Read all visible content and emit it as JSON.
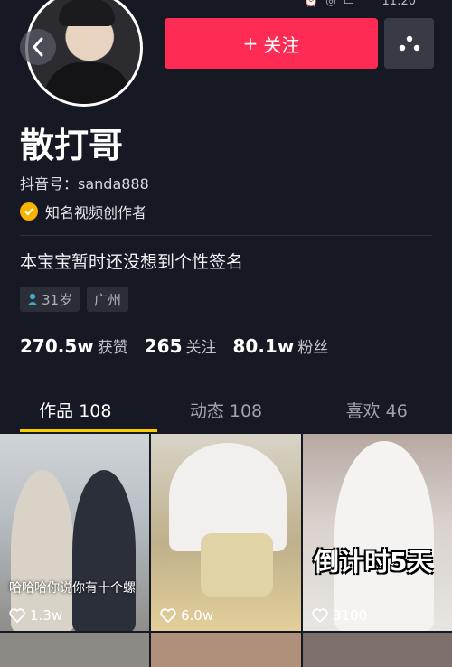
{
  "status": {
    "time": "11:20",
    "icons": [
      "alarm-icon",
      "signal-icon",
      "battery-icon"
    ]
  },
  "profile": {
    "name": "散打哥",
    "douyin_id": "抖音号：sanda888",
    "verification": "知名视频创作者",
    "bio": "本宝宝暂时还没想到个性签名",
    "tags": {
      "age": "31岁",
      "city": "广州"
    }
  },
  "actions": {
    "follow_label": "关注"
  },
  "stats": [
    {
      "value": "270.5w",
      "label": "获赞"
    },
    {
      "value": "265",
      "label": "关注"
    },
    {
      "value": "80.1w",
      "label": "粉丝"
    }
  ],
  "tabs": [
    {
      "label": "作品 108"
    },
    {
      "label": "动态 108"
    },
    {
      "label": "喜欢 46"
    }
  ],
  "videos": [
    {
      "likes": "1.3w",
      "caption": "哈哈哈你说你有十个螺"
    },
    {
      "likes": "6.0w",
      "caption": ""
    },
    {
      "likes": "3100",
      "caption": "倒计时5天"
    }
  ],
  "colors": {
    "background": "#161823",
    "follow": "#fe2c55",
    "tab_indicator": "#facd00",
    "verified": "#f7b500"
  }
}
